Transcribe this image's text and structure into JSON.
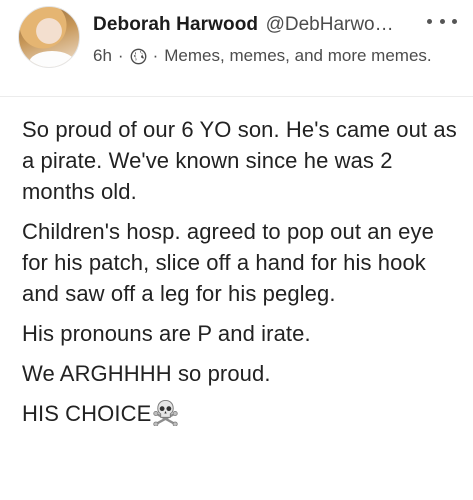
{
  "post": {
    "author": {
      "display_name": "Deborah Harwood",
      "handle": "@DebHarwo…"
    },
    "meta": {
      "time": "6h",
      "separator": "·",
      "audience_icon": "globe-icon",
      "group": "Memes, memes, and more memes."
    },
    "menu_icon": "more-options-icon",
    "paragraphs": [
      "So proud of our 6 YO son. He's came out as a pirate. We've known since he was 2 months old.",
      "Children's hosp. agreed to pop out an eye for his patch, slice off a hand for his hook and saw off a leg for his pegleg.",
      "His pronouns are P and irate.",
      "We ARGHHHH so proud.",
      "HIS CHOICE"
    ],
    "trailing_emoji": "skull-and-crossbones-icon"
  }
}
